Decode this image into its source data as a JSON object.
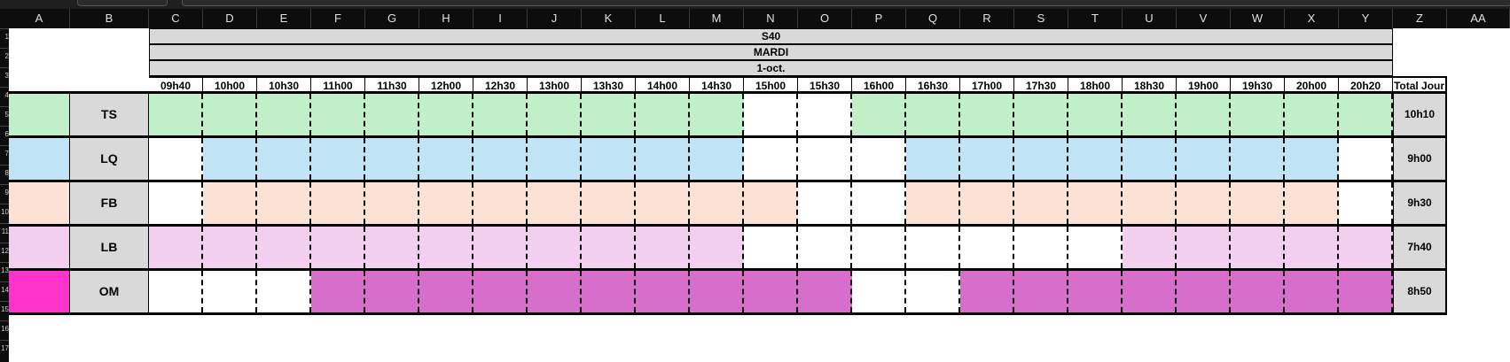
{
  "columns": [
    "A",
    "B",
    "C",
    "D",
    "E",
    "F",
    "G",
    "H",
    "I",
    "J",
    "K",
    "L",
    "M",
    "N",
    "O",
    "P",
    "Q",
    "R",
    "S",
    "T",
    "U",
    "V",
    "W",
    "X",
    "Y",
    "Z",
    "AA"
  ],
  "row_numbers": [
    "1",
    "2",
    "3",
    "4",
    "5",
    "6",
    "7",
    "8",
    "9",
    "10",
    "11",
    "12",
    "13",
    "14",
    "15",
    "16",
    "17"
  ],
  "header": {
    "week": "S40",
    "day": "MARDI",
    "date": "1-oct.",
    "total_label": "Total Jour"
  },
  "times": [
    "09h40",
    "10h00",
    "10h30",
    "11h00",
    "11h30",
    "12h00",
    "12h30",
    "13h00",
    "13h30",
    "14h00",
    "14h30",
    "15h00",
    "15h30",
    "16h00",
    "16h30",
    "17h00",
    "17h30",
    "18h00",
    "18h30",
    "19h00",
    "19h30",
    "20h00",
    "20h20"
  ],
  "colors": {
    "TS": "#c1f0c8",
    "LQ": "#c0e4f5",
    "FB": "#fbe2d5",
    "LB": "#f2ceef",
    "OM": "#d86ecc",
    "OM_marker": "#ff33cc",
    "empty": "#ffffff"
  },
  "employees": [
    {
      "code": "TS",
      "total": "10h10",
      "marker": "TS",
      "slots": [
        1,
        1,
        1,
        1,
        1,
        1,
        1,
        1,
        1,
        1,
        1,
        0,
        0,
        1,
        1,
        1,
        1,
        1,
        1,
        1,
        1,
        1,
        1
      ]
    },
    {
      "code": "LQ",
      "total": "9h00",
      "marker": "LQ",
      "slots": [
        0,
        1,
        1,
        1,
        1,
        1,
        1,
        1,
        1,
        1,
        1,
        0,
        0,
        0,
        1,
        1,
        1,
        1,
        1,
        1,
        1,
        1,
        0
      ]
    },
    {
      "code": "FB",
      "total": "9h30",
      "marker": "FB",
      "slots": [
        0,
        1,
        1,
        1,
        1,
        1,
        1,
        1,
        1,
        1,
        1,
        1,
        0,
        0,
        1,
        1,
        1,
        1,
        1,
        1,
        1,
        1,
        0
      ]
    },
    {
      "code": "LB",
      "total": "7h40",
      "marker": "LB",
      "slots": [
        1,
        1,
        1,
        1,
        1,
        1,
        1,
        1,
        1,
        1,
        1,
        0,
        0,
        0,
        0,
        0,
        0,
        0,
        1,
        1,
        1,
        1,
        1
      ]
    },
    {
      "code": "OM",
      "total": "8h50",
      "marker": "OM_marker",
      "slots": [
        0,
        0,
        0,
        1,
        1,
        1,
        1,
        1,
        1,
        1,
        1,
        1,
        1,
        0,
        0,
        1,
        1,
        1,
        1,
        1,
        1,
        1,
        1
      ]
    }
  ]
}
